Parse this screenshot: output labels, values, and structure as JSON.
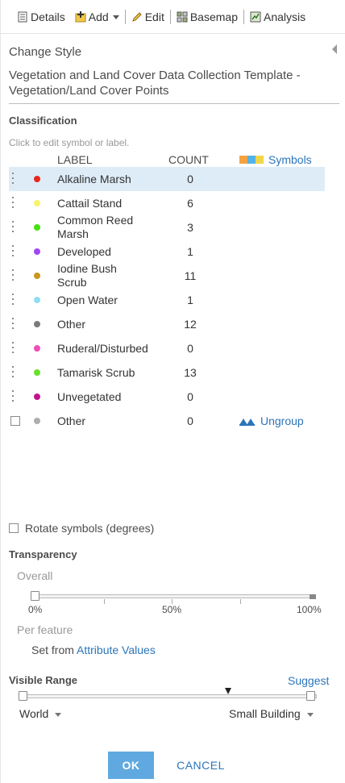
{
  "toolbar": {
    "items": [
      {
        "label": "Details",
        "icon": "details-icon"
      },
      {
        "label": "Add",
        "icon": "add-icon"
      },
      {
        "label": "Edit",
        "icon": "pencil-icon"
      },
      {
        "label": "Basemap",
        "icon": "basemap-grid-icon"
      },
      {
        "label": "Analysis",
        "icon": "analysis-icon"
      }
    ]
  },
  "panel": {
    "title": "Change Style",
    "layer_name": "Vegetation and Land Cover Data Collection Template - Vegetation/Land Cover Points"
  },
  "classification": {
    "heading": "Classification",
    "hint": "Click to edit symbol or label.",
    "label_header": "LABEL",
    "count_header": "COUNT",
    "symbols_link": "Symbols",
    "symbols_ramp_colors": [
      "#f4a340",
      "#53b3e6",
      "#f2d64a"
    ],
    "rows": [
      {
        "label": "Alkaline Marsh",
        "count": "0",
        "color": "#e8271f",
        "selected": true
      },
      {
        "label": "Cattail Stand",
        "count": "6",
        "color": "#f6f46a"
      },
      {
        "label": "Common Reed Marsh",
        "count": "3",
        "color": "#46e10f"
      },
      {
        "label": "Developed",
        "count": "1",
        "color": "#a246f3"
      },
      {
        "label": "Iodine Bush Scrub",
        "count": "11",
        "color": "#c8971d"
      },
      {
        "label": "Open Water",
        "count": "1",
        "color": "#8fdcf5"
      },
      {
        "label": "Other",
        "count": "12",
        "color": "#7a7a7a"
      },
      {
        "label": "Ruderal/Disturbed",
        "count": "0",
        "color": "#ef4fb8"
      },
      {
        "label": "Tamarisk Scrub",
        "count": "13",
        "color": "#68e02b"
      },
      {
        "label": "Unvegetated",
        "count": "0",
        "color": "#c1168b"
      }
    ],
    "other_row": {
      "label": "Other",
      "count": "0",
      "color": "#adadad"
    },
    "ungroup_link": "Ungroup"
  },
  "rotate": {
    "label": "Rotate symbols (degrees)",
    "checked": false
  },
  "transparency": {
    "heading": "Transparency",
    "overall_label": "Overall",
    "overall_value_pct": 0,
    "ticks": [
      "0%",
      "50%",
      "100%"
    ],
    "per_feature_label": "Per feature",
    "set_from_prefix": "Set from",
    "attribute_values_link": "Attribute Values"
  },
  "visible_range": {
    "heading": "Visible Range",
    "suggest_link": "Suggest",
    "min_scale": "World",
    "max_scale": "Small Building"
  },
  "buttons": {
    "ok": "OK",
    "cancel": "CANCEL"
  }
}
